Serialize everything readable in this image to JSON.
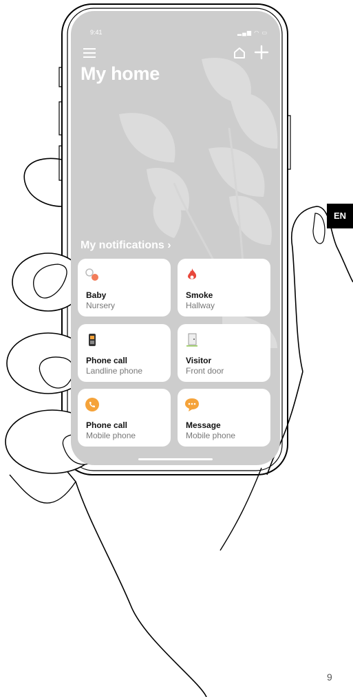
{
  "status_bar": {
    "time": "9:41"
  },
  "header": {
    "title": "My home"
  },
  "notifications": {
    "heading": "My notifications",
    "cards": [
      {
        "title": "Baby",
        "subtitle": "Nursery",
        "icon": "pacifier-icon"
      },
      {
        "title": "Smoke",
        "subtitle": "Hallway",
        "icon": "flame-icon"
      },
      {
        "title": "Phone call",
        "subtitle": "Landline phone",
        "icon": "landline-phone-icon"
      },
      {
        "title": "Visitor",
        "subtitle": "Front door",
        "icon": "door-icon"
      },
      {
        "title": "Phone call",
        "subtitle": "Mobile phone",
        "icon": "mobile-phone-icon"
      },
      {
        "title": "Message",
        "subtitle": "Mobile phone",
        "icon": "message-icon"
      }
    ]
  },
  "page": {
    "language_badge": "EN",
    "page_number": "9"
  },
  "colors": {
    "screen_bg": "#cdcdcd",
    "card_bg": "#ffffff",
    "smoke_red": "#e8473b",
    "orange": "#f5a33a",
    "badge_bg": "#000000"
  }
}
